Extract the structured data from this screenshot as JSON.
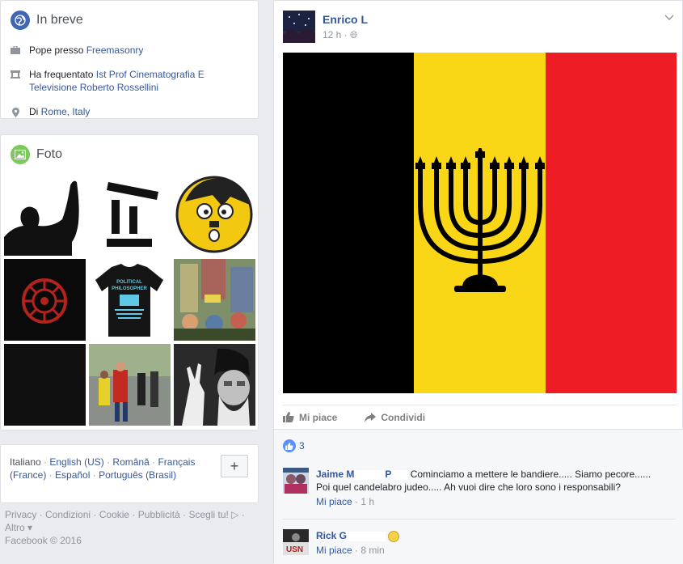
{
  "intro": {
    "title": "In breve",
    "rows": [
      {
        "icon": "briefcase-icon",
        "prefix": "Pope presso ",
        "link": "Freemasonry"
      },
      {
        "icon": "graduation-cap-icon",
        "prefix": "Ha frequentato ",
        "link": "Ist Prof Cinematografia E Televisione Roberto Rossellini"
      },
      {
        "icon": "location-pin-icon",
        "prefix": "Di ",
        "link": "Rome, Italy"
      }
    ]
  },
  "photos": {
    "title": "Foto",
    "tiles": [
      {
        "name": "photo-salute-silhouette",
        "bg": "#ffffff"
      },
      {
        "name": "photo-mustache-face",
        "bg": "#ffffff"
      },
      {
        "name": "photo-yellow-smiley",
        "bg": "#ffffff"
      },
      {
        "name": "photo-red-symbol",
        "bg": "#0a0a0a"
      },
      {
        "name": "photo-tshirt",
        "bg": "#ffffff"
      },
      {
        "name": "photo-comic-crowd",
        "bg": "#4a5a3a"
      },
      {
        "name": "photo-dark",
        "bg": "#101010"
      },
      {
        "name": "photo-street-crowd",
        "bg": "#7a8a6a"
      },
      {
        "name": "photo-bearded-man",
        "bg": "#888888"
      }
    ],
    "tshirt_text": "POLITICAL PHILOSOPHER"
  },
  "languages": {
    "items": [
      "Italiano",
      "English (US)",
      "Română",
      "Français (France)",
      "Español",
      "Português (Brasil)"
    ],
    "add_label": "+"
  },
  "footer": {
    "links": [
      "Privacy",
      "Condizioni",
      "Cookie",
      "Pubblicità",
      "Scegli tu!"
    ],
    "more": "Altro",
    "copyright": "Facebook © 2016"
  },
  "post": {
    "author": "Enrico L",
    "time": "12 h ·",
    "flag_colors": [
      "#000000",
      "#f9d616",
      "#ee1c25"
    ],
    "menorah_color": "#000000",
    "like_label": "Mi piace",
    "share_label": "Condividi",
    "reaction_count": "3"
  },
  "comments": [
    {
      "author": "Jaime M",
      "author_tail": "P",
      "text": "Cominciamo a mettere le bandiere..... Siamo pecore...... Poi quel candelabro judeo..... Ah vuoi dire che loro sono i responsabili?",
      "like_label": "Mi piace",
      "time": "1 h"
    },
    {
      "author": "Rick G",
      "text": "",
      "like_label": "Mi piace",
      "time": "8 min",
      "avatar_text": "USN"
    }
  ],
  "colors": {
    "link": "#365899",
    "muted": "#90949c",
    "accent": "#4267b2"
  }
}
